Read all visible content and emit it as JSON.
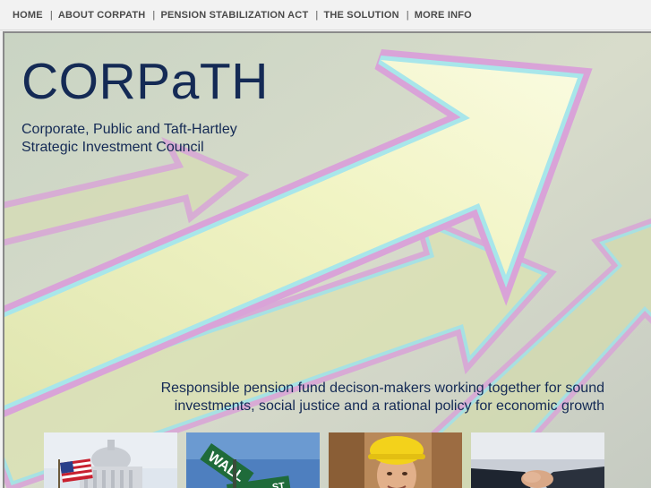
{
  "nav": {
    "items": [
      {
        "label": "HOME"
      },
      {
        "label": "ABOUT CORPATH"
      },
      {
        "label": "PENSION STABILIZATION ACT"
      },
      {
        "label": "THE SOLUTION"
      },
      {
        "label": "MORE INFO"
      }
    ],
    "separator": "|"
  },
  "header": {
    "logo": "CORPaTH",
    "subtitle_line1": "Corporate, Public and Taft-Hartley",
    "subtitle_line2": "Strategic Investment Council"
  },
  "tagline": {
    "line1": "Responsible pension fund decison-makers working together for sound",
    "line2": "investments, social justice and a rational policy for economic growth"
  },
  "photos": [
    {
      "icon": "capitol-flag-photo"
    },
    {
      "icon": "wall-street-sign-photo",
      "sign_text": "WALL",
      "sign_text2": "ST"
    },
    {
      "icon": "construction-worker-photo"
    },
    {
      "icon": "handshake-photo"
    }
  ],
  "colors": {
    "text_primary": "#142a55",
    "nav_text": "#4a4a4a",
    "arrow_fill": "#eef2b8",
    "arrow_glow_pink": "#d9a3d8",
    "arrow_glow_cyan": "#9fe3e8"
  }
}
